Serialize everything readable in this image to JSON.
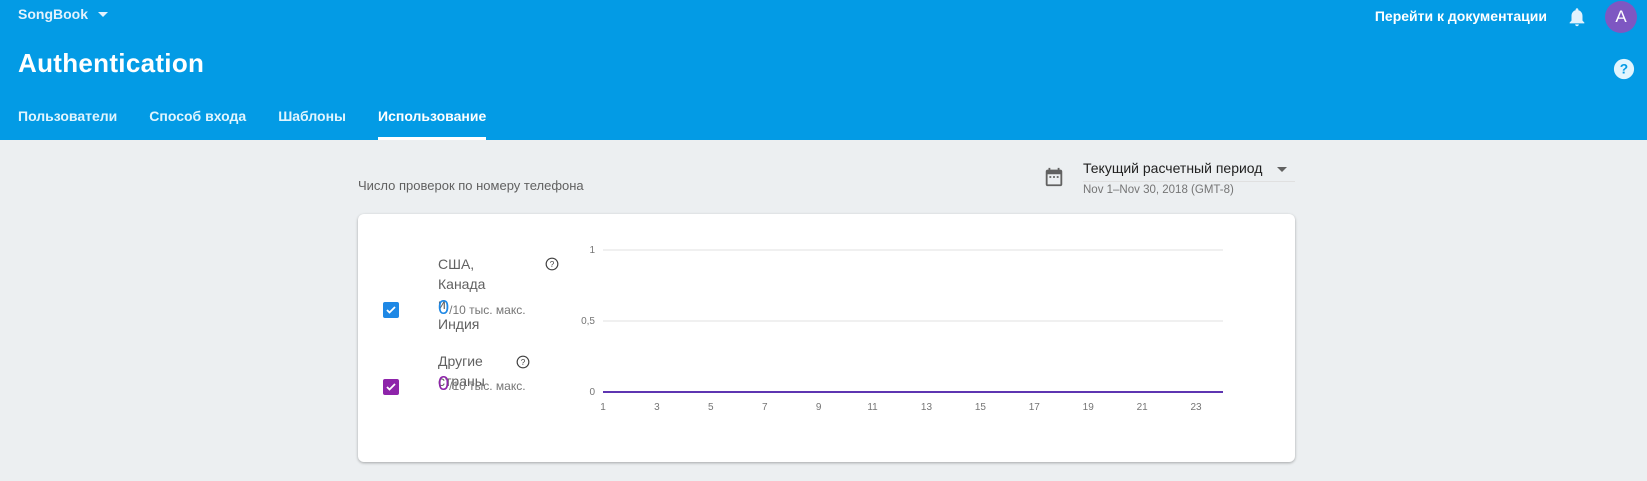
{
  "header": {
    "project_name": "SongBook",
    "docs_link": "Перейти к документации",
    "avatar_letter": "A",
    "page_title": "Authentication",
    "tabs": [
      {
        "label": "Пользователи",
        "active": false
      },
      {
        "label": "Способ входа",
        "active": false
      },
      {
        "label": "Шаблоны",
        "active": false
      },
      {
        "label": "Использование",
        "active": true
      }
    ]
  },
  "section": {
    "title": "Число проверок по номеру телефона"
  },
  "period": {
    "selected": "Текущий расчетный период",
    "range": "Nov 1–Nov 30, 2018 (GMT-8)"
  },
  "metrics": [
    {
      "label_line1": "США, Канада и",
      "label_line2": "Индия",
      "value": "0",
      "suffix": "/10 тыс. макс.",
      "color": "#1e88e5",
      "checked": true
    },
    {
      "label_line1": "Другие страны",
      "value": "0",
      "suffix": "/10 тыс. макс.",
      "color": "#8e24aa",
      "checked": true
    }
  ],
  "chart_data": {
    "type": "line",
    "x": [
      1,
      2,
      3,
      4,
      5,
      6,
      7,
      8,
      9,
      10,
      11,
      12,
      13,
      14,
      15,
      16,
      17,
      18,
      19,
      20,
      21,
      22,
      23,
      24
    ],
    "x_tick_labels": [
      "1",
      "3",
      "5",
      "7",
      "9",
      "11",
      "13",
      "15",
      "17",
      "19",
      "21",
      "23"
    ],
    "y_tick_labels": [
      "0",
      "0,5",
      "1"
    ],
    "ylim": [
      0,
      1
    ],
    "grid": true,
    "series": [
      {
        "name": "США, Канада и Индия",
        "color": "#1e88e5",
        "values": [
          0,
          0,
          0,
          0,
          0,
          0,
          0,
          0,
          0,
          0,
          0,
          0,
          0,
          0,
          0,
          0,
          0,
          0,
          0,
          0,
          0,
          0,
          0,
          0
        ]
      },
      {
        "name": "Другие страны",
        "color": "#5e35b1",
        "values": [
          0,
          0,
          0,
          0,
          0,
          0,
          0,
          0,
          0,
          0,
          0,
          0,
          0,
          0,
          0,
          0,
          0,
          0,
          0,
          0,
          0,
          0,
          0,
          0
        ]
      }
    ]
  },
  "colors": {
    "header_bg": "#039be5",
    "page_bg": "#eceff1",
    "avatar_bg": "#7e57c2"
  },
  "icons": {
    "bell": "bell-icon",
    "help": "help-icon",
    "calendar": "calendar-icon",
    "caret": "chevron-down-icon",
    "check": "check-icon"
  }
}
